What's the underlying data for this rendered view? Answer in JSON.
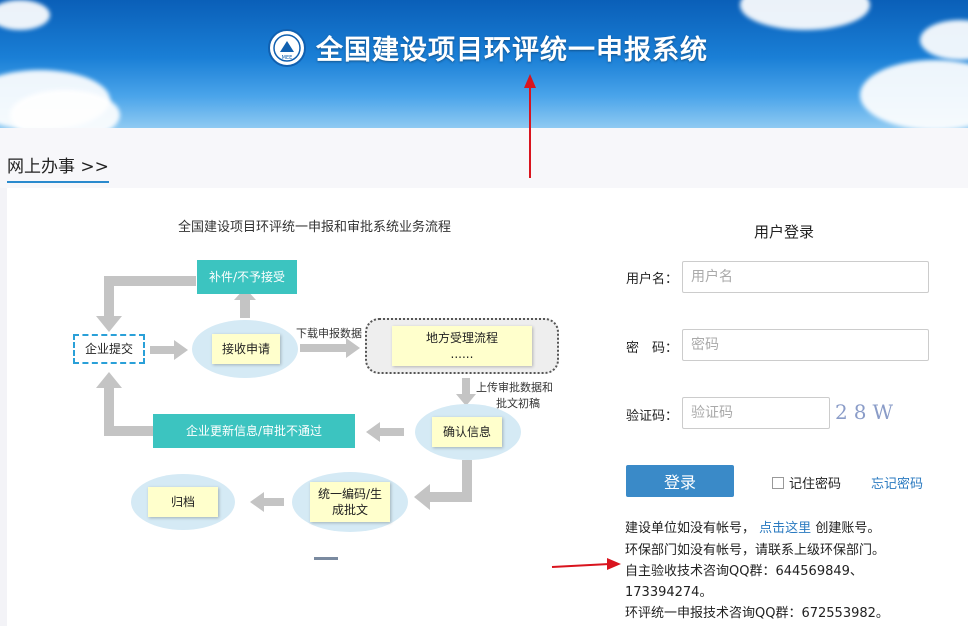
{
  "header": {
    "title": "全国建设项目环评统一申报系统",
    "emblem_text": "MEE"
  },
  "breadcrumb": {
    "label": "网上办事 >>"
  },
  "flow": {
    "title": "全国建设项目环评统一申报和审批系统业务流程",
    "nodes": {
      "supplement": "补件/不予接受",
      "submit": "企业提交",
      "receive": "接收申请",
      "download_label": "下载申报数据",
      "local_process": "地方受理流程",
      "local_dots": "......",
      "upload_label_1": "上传审批数据和",
      "upload_label_2": "批文初稿",
      "confirm": "确认信息",
      "update": "企业更新信息/审批不通过",
      "archive": "归档",
      "encode_1": "统一编码/生",
      "encode_2": "成批文"
    }
  },
  "login": {
    "title": "用户登录",
    "username_label": "用户名：",
    "username_placeholder": "用户名",
    "password_label": "密　码：",
    "password_placeholder": "密码",
    "captcha_label": "验证码：",
    "captcha_placeholder": "验证码",
    "captcha_text": "28W",
    "login_button": "登录",
    "remember_label": "记住密码",
    "forgot_link": "忘记密码",
    "info": {
      "line1_pre": "建设单位如没有帐号，",
      "line1_link": "点击这里",
      "line1_post": "创建账号。",
      "line2": "环保部门如没有帐号，请联系上级环保部门。",
      "line3": "自主验收技术咨询QQ群：644569849、",
      "line4": "173394274。",
      "line5": "环评统一申报技术咨询QQ群：672553982。"
    }
  },
  "colors": {
    "teal": "#3cc4c0",
    "yellow_box": "#ffffcc",
    "accent_blue": "#3a8ac8",
    "annotation_red": "#d9141e"
  }
}
